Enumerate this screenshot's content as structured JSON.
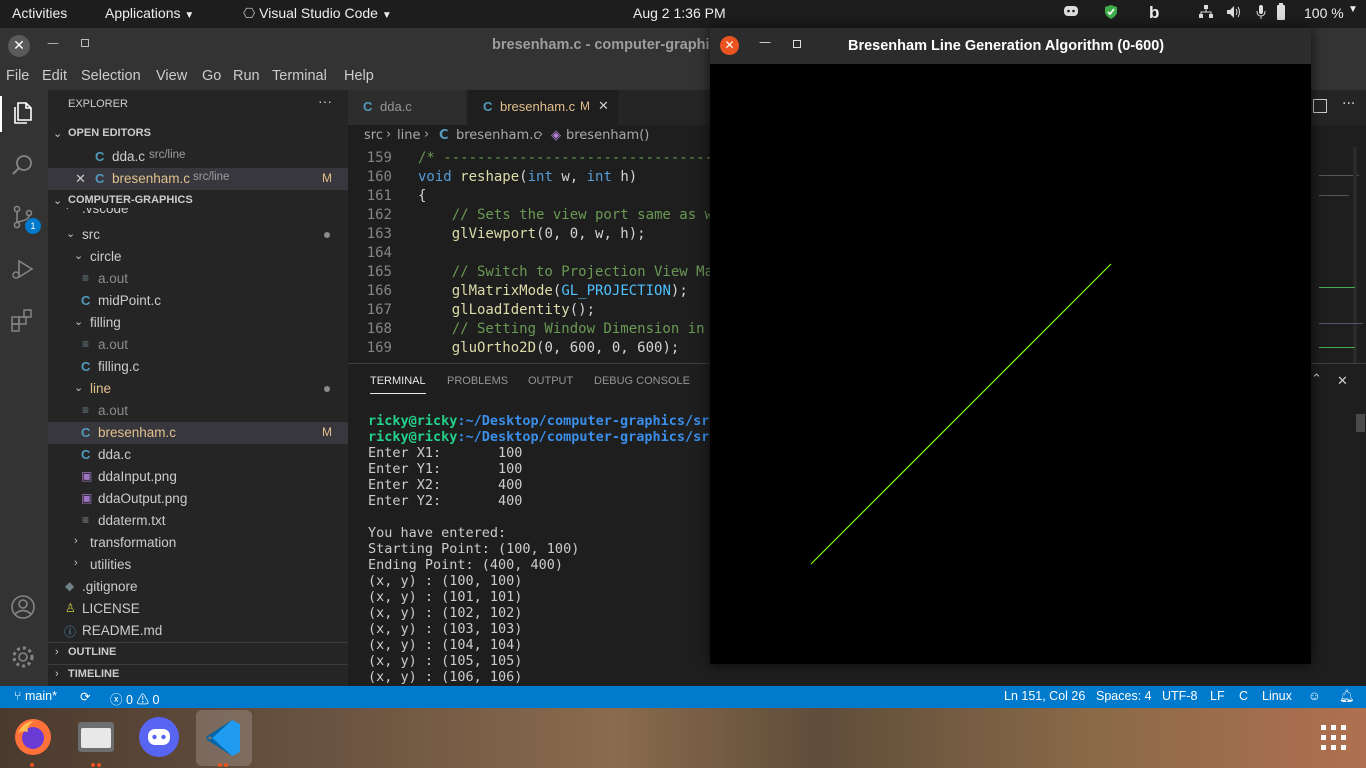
{
  "topbar": {
    "activities": "Activities",
    "applications": "Applications",
    "app_name": "Visual Studio Code",
    "clock": "Aug 2   1:36 PM",
    "battery": "100 %"
  },
  "vscode": {
    "title": "bresenham.c - computer-graphi",
    "menu": [
      "File",
      "Edit",
      "Selection",
      "View",
      "Go",
      "Run",
      "Terminal",
      "Help"
    ],
    "scm_badge": "1",
    "sidebar": {
      "title": "EXPLORER",
      "open_editors_label": "OPEN EDITORS",
      "open_editors": [
        {
          "name": "dda.c",
          "path": "src/line"
        },
        {
          "name": "bresenham.c",
          "path": "src/line",
          "status": "M"
        }
      ],
      "project_label": "COMPUTER-GRAPHICS",
      "tree": {
        "vscode": ".vscode",
        "src": "src",
        "circle": "circle",
        "circle_aout": "a.out",
        "midpoint": "midPoint.c",
        "filling": "filling",
        "filling_aout": "a.out",
        "filling_c": "filling.c",
        "line": "line",
        "line_aout": "a.out",
        "bresenham": "bresenham.c",
        "bresenham_status": "M",
        "dda": "dda.c",
        "ddainput": "ddaInput.png",
        "ddaoutput": "ddaOutput.png",
        "ddaterm": "ddaterm.txt",
        "transformation": "transformation",
        "utilities": "utilities",
        "gitignore": ".gitignore",
        "license": "LICENSE",
        "readme": "README.md"
      },
      "outline_label": "OUTLINE",
      "timeline_label": "TIMELINE"
    },
    "tabs": [
      {
        "label": "dda.c"
      },
      {
        "label": "bresenham.c",
        "status": "M"
      }
    ],
    "breadcrumb": {
      "seg1": "src",
      "seg2": "line",
      "seg3": "bresenham.c",
      "seg4": "bresenham()"
    },
    "editor": {
      "line_numbers": [
        "159",
        "160",
        "161",
        "162",
        "163",
        "164",
        "165",
        "166",
        "167",
        "168",
        "169"
      ],
      "lines": {
        "l159": "/* -----------------------------------------",
        "l160_kw1": "void",
        "l160_fn": "reshape",
        "l160_rest1": "(",
        "l160_kw2": "int",
        "l160_rest2": " w, ",
        "l160_kw3": "int",
        "l160_rest3": " h)",
        "l161": "{",
        "l162": "    // Sets the view port same as w",
        "l163_fn": "glViewport",
        "l163_rest": "(0, 0, w, h);",
        "l165": "    // Switch to Projection View Ma",
        "l166_fn": "glMatrixMode",
        "l166_open": "(",
        "l166_cn": "GL_PROJECTION",
        "l166_close": ");",
        "l167_fn": "glLoadIdentity",
        "l167_rest": "();",
        "l168": "    // Setting Window Dimension in ",
        "l169_fn": "gluOrtho2D",
        "l169_rest": "(0, 600, 0, 600);"
      }
    },
    "panel": {
      "tabs": [
        "TERMINAL",
        "PROBLEMS",
        "OUTPUT",
        "DEBUG CONSOLE"
      ],
      "prompt_user": "ricky@ricky",
      "prompt_path": ":~/Desktop/computer-graphics/src",
      "terminal_lines": [
        "Enter X1:       100",
        "Enter Y1:       100",
        "Enter X2:       400",
        "Enter Y2:       400",
        "",
        "You have entered:",
        "Starting Point: (100, 100)",
        "Ending Point: (400, 400)",
        "(x, y) : (100, 100)",
        "(x, y) : (101, 101)",
        "(x, y) : (102, 102)",
        "(x, y) : (103, 103)",
        "(x, y) : (104, 104)",
        "(x, y) : (105, 105)",
        "(x, y) : (106, 106)"
      ]
    },
    "statusbar": {
      "branch": "main*",
      "problems_errors": "0",
      "problems_warnings": "0",
      "cursor": "Ln 151, Col 26",
      "spaces": "Spaces: 4",
      "encoding": "UTF-8",
      "eol": "LF",
      "language": "C",
      "platform": "Linux"
    }
  },
  "glwindow": {
    "title": "Bresenham Line Generation Algorithm (0-600)",
    "line_color": "#7fff00",
    "line_from": [
      100,
      100
    ],
    "line_to": [
      400,
      400
    ],
    "ortho": [
      0,
      600,
      0,
      600
    ]
  },
  "colors": {
    "accent": "#007acc",
    "close_button": "#e95420"
  }
}
